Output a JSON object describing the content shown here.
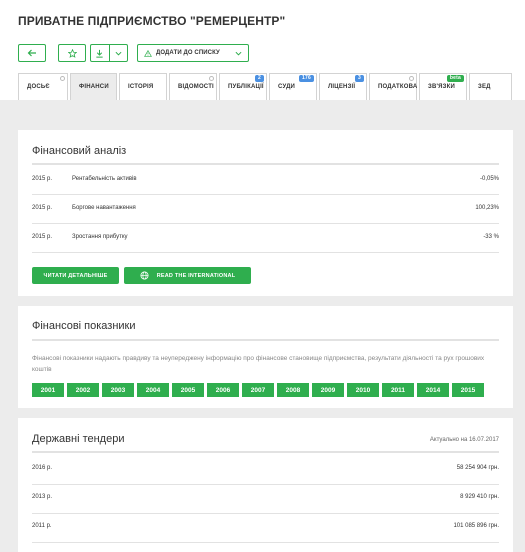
{
  "company": {
    "title": "ПРИВАТНЕ ПІДПРИЄМСТВО \"РЕМЕРЦЕНТР\""
  },
  "toolbar": {
    "add_to_list_label": "ДОДАТИ ДО СПИСКУ"
  },
  "tabs": [
    {
      "label": "ДОСЬЄ",
      "active": false,
      "marker": "dot"
    },
    {
      "label": "ФІНАНСИ",
      "active": true
    },
    {
      "label": "ІСТОРІЯ",
      "active": false
    },
    {
      "label": "ВІДОМОСТІ",
      "active": false,
      "marker": "dot"
    },
    {
      "label": "ПУБЛІКАЦІЇ",
      "active": false,
      "badge": "2"
    },
    {
      "label": "СУДИ",
      "active": false,
      "badge": "176"
    },
    {
      "label": "ЛІЦЕНЗІЇ",
      "active": false,
      "badge": "3"
    },
    {
      "label": "ПОДАТКОВА",
      "active": false,
      "marker": "dot"
    },
    {
      "label": "ЗВ'ЯЗКИ",
      "active": false,
      "badge": "beta"
    },
    {
      "label": "ЗЕД",
      "active": false
    }
  ],
  "financial_analysis": {
    "title": "Фінансовий аналіз",
    "rows": [
      {
        "year": "2015 р.",
        "label": "Рентабельність активів",
        "value": "-0,05%"
      },
      {
        "year": "2015 р.",
        "label": "Боргове навантаження",
        "value": "100,23%"
      },
      {
        "year": "2015 р.",
        "label": "Зростання прибутку",
        "value": "-33 %"
      }
    ],
    "read_more_label": "ЧИТАТИ ДЕТАЛЬНІШЕ",
    "read_intl_label": "READ THE INTERNATIONAL"
  },
  "financial_indicators": {
    "title": "Фінансові показники",
    "description": "Фінансові показники надають правдиву та неупереджену інформацію про фінансове становище підприємства, результати діяльності та рух грошових коштів",
    "years": [
      "2001",
      "2002",
      "2003",
      "2004",
      "2005",
      "2006",
      "2007",
      "2008",
      "2009",
      "2010",
      "2011",
      "2014",
      "2015"
    ]
  },
  "tenders": {
    "title": "Державні тендери",
    "updated": "Актуально на 16.07.2017",
    "rows": [
      {
        "year": "2016 р.",
        "amount": "58 254 904 грн."
      },
      {
        "year": "2013 р.",
        "amount": "8 929 410 грн."
      },
      {
        "year": "2011 р.",
        "amount": "101 085 896 грн."
      }
    ]
  },
  "colors": {
    "accent": "#2fae4e",
    "badge_blue": "#4a90e2",
    "background": "#ececec"
  }
}
